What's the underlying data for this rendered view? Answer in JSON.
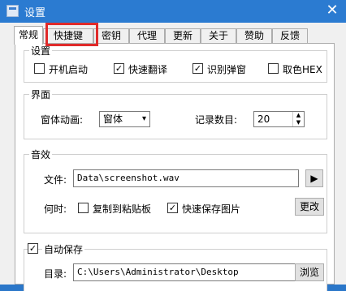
{
  "window": {
    "title": "设置",
    "close_glyph": "✕"
  },
  "tabs": [
    {
      "label": "常规",
      "active": true
    },
    {
      "label": "快捷键"
    },
    {
      "label": "密钥"
    },
    {
      "label": "代理"
    },
    {
      "label": "更新"
    },
    {
      "label": "关于"
    },
    {
      "label": "赞助"
    },
    {
      "label": "反馈"
    }
  ],
  "settings": {
    "title": "设置",
    "autostart": {
      "label": "开机启动",
      "checked": false
    },
    "quick_translate": {
      "label": "快速翻译",
      "checked": true
    },
    "recognize_popup": {
      "label": "识别弹窗",
      "checked": true
    },
    "pick_hex": {
      "label": "取色HEX",
      "checked": false
    }
  },
  "interface": {
    "title": "界面",
    "animation_label": "窗体动画:",
    "animation_value": "窗体",
    "records_label": "记录数目:",
    "records_value": "20"
  },
  "sound": {
    "title": "音效",
    "file_label": "文件:",
    "file_value": "Data\\screenshot.wav",
    "when_label": "何时:",
    "copy_clipboard": {
      "label": "复制到粘贴板",
      "checked": false
    },
    "quick_save": {
      "label": "快速保存图片",
      "checked": true
    },
    "change_button": "更改"
  },
  "autosave": {
    "title": "自动保存",
    "checked": true,
    "dir_label": "目录:",
    "dir_value": "C:\\Users\\Administrator\\Desktop",
    "browse_button": "浏览"
  }
}
